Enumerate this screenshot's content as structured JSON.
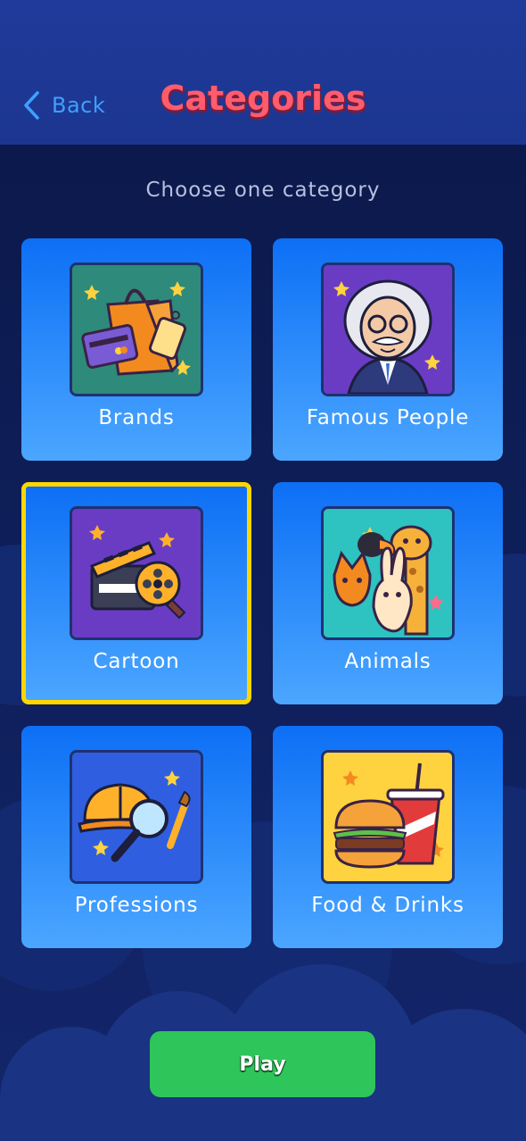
{
  "header": {
    "back_label": "Back",
    "title": "Categories"
  },
  "subtitle": "Choose one category",
  "categories": [
    {
      "label": "Brands",
      "icon": "shopping-bag-card-icon",
      "selected": false
    },
    {
      "label": "Famous People",
      "icon": "scientist-portrait-icon",
      "selected": false
    },
    {
      "label": "Cartoon",
      "icon": "clapperboard-film-reel-icon",
      "selected": true
    },
    {
      "label": "Animals",
      "icon": "animals-group-icon",
      "selected": false
    },
    {
      "label": "Professions",
      "icon": "hardhat-magnifier-brush-icon",
      "selected": false
    },
    {
      "label": "Food & Drinks",
      "icon": "burger-soda-icon",
      "selected": false
    }
  ],
  "play_label": "Play",
  "colors": {
    "background": "#0a1a52",
    "header": "#1f3a9a",
    "accent": "#3fa0ff",
    "title": "#ff5c6e",
    "selected_border": "#ffd600",
    "play": "#2ec55b"
  }
}
